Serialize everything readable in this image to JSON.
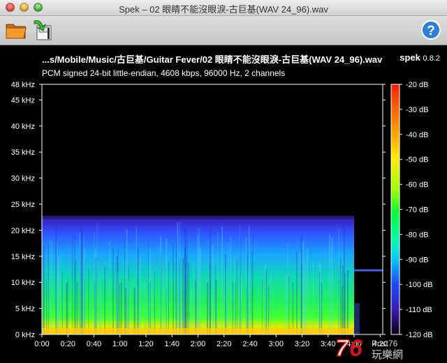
{
  "window": {
    "title": "Spek – 02 眼睛不能沒眼淚-古巨基(WAV 24_96).wav"
  },
  "toolbar": {
    "open_icon": "folder-icon",
    "save_icon": "save-icon",
    "help_icon": "help-icon"
  },
  "header": {
    "file_path": "...s/Mobile/Music/古巨基/Guitar Fever/02 眼睛不能沒眼淚-古巨基(WAV 24_96).wav",
    "app_name": "spek",
    "app_version": "0.8.2",
    "file_info": "PCM signed 24-bit little-endian, 4608 kbps, 96000 Hz, 2 channels"
  },
  "chart_data": {
    "type": "heatmap",
    "y_ticks": [
      "0 kHz",
      "5 kHz",
      "10 kHz",
      "15 kHz",
      "20 kHz",
      "25 kHz",
      "30 kHz",
      "35 kHz",
      "40 kHz",
      "45 kHz",
      "48 kHz"
    ],
    "y_values": [
      0,
      5,
      10,
      15,
      20,
      25,
      30,
      35,
      40,
      45,
      48
    ],
    "ylim": [
      0,
      48
    ],
    "x_ticks": [
      "0:00",
      "0:20",
      "0:40",
      "1:00",
      "1:20",
      "1:40",
      "2:00",
      "2:20",
      "2:40",
      "3:00",
      "3:20",
      "3:40",
      "4:00",
      "4:20"
    ],
    "x_seconds": [
      0,
      20,
      40,
      60,
      80,
      100,
      120,
      140,
      160,
      180,
      200,
      220,
      240,
      260
    ],
    "xlim": [
      0,
      262
    ],
    "colorbar_ticks": [
      "-20 dB",
      "-30 dB",
      "-40 dB",
      "-50 dB",
      "-60 dB",
      "-70 dB",
      "-80 dB",
      "-90 dB",
      "-100 dB",
      "-110 dB",
      "-120 dB"
    ],
    "colorbar_values": [
      -20,
      -30,
      -40,
      -50,
      -60,
      -70,
      -80,
      -90,
      -100,
      -110,
      -120
    ],
    "colorbar_range": [
      -120,
      -20
    ],
    "content_cutoff_khz": 22,
    "music_end_seconds": 240
  },
  "watermark": {
    "text": "Post76",
    "subtext": "玩樂網"
  }
}
